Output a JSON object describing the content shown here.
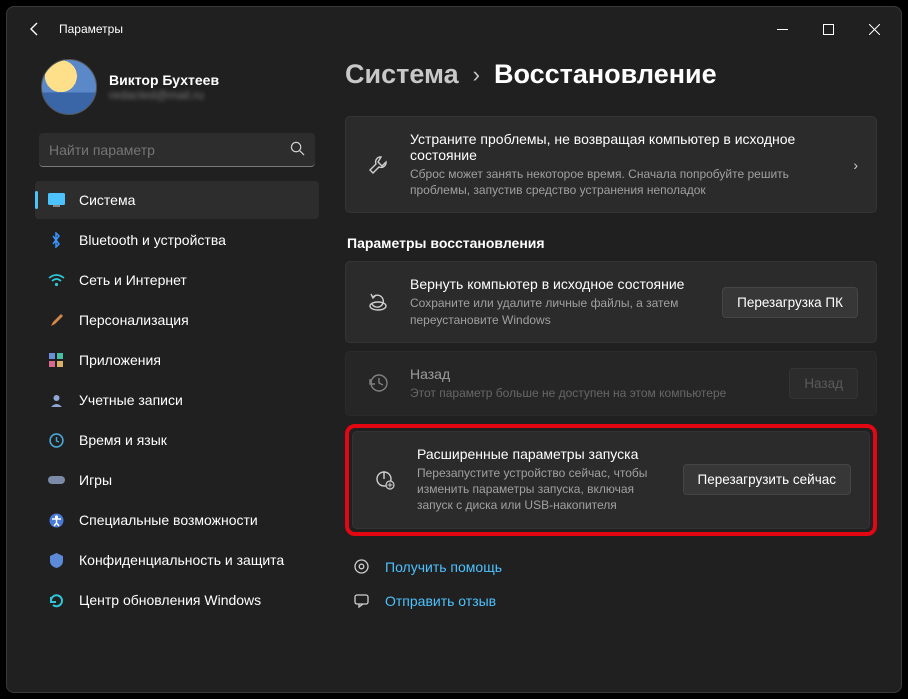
{
  "window": {
    "title": "Параметры"
  },
  "profile": {
    "name": "Виктор Бухтеев",
    "email": "redacted@mail.ru"
  },
  "search": {
    "placeholder": "Найти параметр"
  },
  "sidebar": {
    "items": [
      {
        "label": "Система",
        "selected": true
      },
      {
        "label": "Bluetooth и устройства"
      },
      {
        "label": "Сеть и Интернет"
      },
      {
        "label": "Персонализация"
      },
      {
        "label": "Приложения"
      },
      {
        "label": "Учетные записи"
      },
      {
        "label": "Время и язык"
      },
      {
        "label": "Игры"
      },
      {
        "label": "Специальные возможности"
      },
      {
        "label": "Конфиденциальность и защита"
      },
      {
        "label": "Центр обновления Windows"
      }
    ]
  },
  "breadcrumb": {
    "parent": "Система",
    "current": "Восстановление"
  },
  "troubleshoot": {
    "title": "Устраните проблемы, не возвращая компьютер в исходное состояние",
    "sub": "Сброс может занять некоторое время. Сначала попробуйте решить проблемы, запустив средство устранения неполадок"
  },
  "section_label": "Параметры восстановления",
  "reset": {
    "title": "Вернуть компьютер в исходное состояние",
    "sub": "Сохраните или удалите личные файлы, а затем переустановите Windows",
    "button": "Перезагрузка ПК"
  },
  "goback": {
    "title": "Назад",
    "sub": "Этот параметр больше не доступен на этом компьютере",
    "button": "Назад"
  },
  "advanced": {
    "title": "Расширенные параметры запуска",
    "sub": "Перезапустите устройство сейчас, чтобы изменить параметры запуска, включая запуск с диска или USB-накопителя",
    "button": "Перезагрузить сейчас"
  },
  "footer": {
    "help": "Получить помощь",
    "feedback": "Отправить отзыв"
  }
}
